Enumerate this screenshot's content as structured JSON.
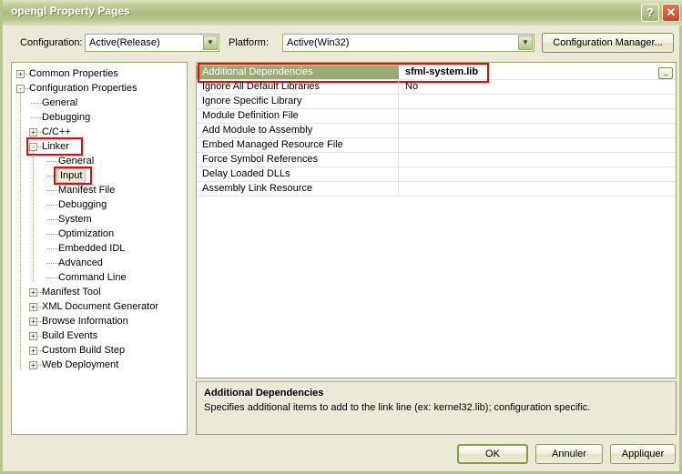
{
  "window": {
    "title": "opengl Property Pages",
    "help_label": "?",
    "close_label": "✕"
  },
  "config_bar": {
    "configuration_label": "Configuration:",
    "configuration_value": "Active(Release)",
    "platform_label": "Platform:",
    "platform_value": "Active(Win32)",
    "configuration_manager_label": "Configuration Manager..."
  },
  "tree": {
    "items": [
      {
        "label": "Common Properties",
        "indent": 0,
        "expander": "+",
        "selected": false,
        "annotated": false
      },
      {
        "label": "Configuration Properties",
        "indent": 0,
        "expander": "-",
        "selected": false,
        "annotated": false
      },
      {
        "label": "General",
        "indent": 1,
        "expander": "",
        "selected": false,
        "annotated": false
      },
      {
        "label": "Debugging",
        "indent": 1,
        "expander": "",
        "selected": false,
        "annotated": false
      },
      {
        "label": "C/C++",
        "indent": 1,
        "expander": "+",
        "selected": false,
        "annotated": false
      },
      {
        "label": "Linker",
        "indent": 1,
        "expander": "-",
        "selected": false,
        "annotated": true
      },
      {
        "label": "General",
        "indent": 2,
        "expander": "",
        "selected": false,
        "annotated": false
      },
      {
        "label": "Input",
        "indent": 2,
        "expander": "",
        "selected": true,
        "annotated": true
      },
      {
        "label": "Manifest File",
        "indent": 2,
        "expander": "",
        "selected": false,
        "annotated": false
      },
      {
        "label": "Debugging",
        "indent": 2,
        "expander": "",
        "selected": false,
        "annotated": false
      },
      {
        "label": "System",
        "indent": 2,
        "expander": "",
        "selected": false,
        "annotated": false
      },
      {
        "label": "Optimization",
        "indent": 2,
        "expander": "",
        "selected": false,
        "annotated": false
      },
      {
        "label": "Embedded IDL",
        "indent": 2,
        "expander": "",
        "selected": false,
        "annotated": false
      },
      {
        "label": "Advanced",
        "indent": 2,
        "expander": "",
        "selected": false,
        "annotated": false
      },
      {
        "label": "Command Line",
        "indent": 2,
        "expander": "",
        "selected": false,
        "annotated": false
      },
      {
        "label": "Manifest Tool",
        "indent": 1,
        "expander": "+",
        "selected": false,
        "annotated": false
      },
      {
        "label": "XML Document Generator",
        "indent": 1,
        "expander": "+",
        "selected": false,
        "annotated": false
      },
      {
        "label": "Browse Information",
        "indent": 1,
        "expander": "+",
        "selected": false,
        "annotated": false
      },
      {
        "label": "Build Events",
        "indent": 1,
        "expander": "+",
        "selected": false,
        "annotated": false
      },
      {
        "label": "Custom Build Step",
        "indent": 1,
        "expander": "+",
        "selected": false,
        "annotated": false
      },
      {
        "label": "Web Deployment",
        "indent": 1,
        "expander": "+",
        "selected": false,
        "annotated": false
      }
    ]
  },
  "grid": {
    "rows": [
      {
        "name": "Additional Dependencies",
        "value": "sfml-system.lib",
        "selected": true,
        "has_ellipsis": true
      },
      {
        "name": "Ignore All Default Libraries",
        "value": "No",
        "selected": false,
        "has_ellipsis": false
      },
      {
        "name": "Ignore Specific Library",
        "value": "",
        "selected": false,
        "has_ellipsis": false
      },
      {
        "name": "Module Definition File",
        "value": "",
        "selected": false,
        "has_ellipsis": false
      },
      {
        "name": "Add Module to Assembly",
        "value": "",
        "selected": false,
        "has_ellipsis": false
      },
      {
        "name": "Embed Managed Resource File",
        "value": "",
        "selected": false,
        "has_ellipsis": false
      },
      {
        "name": "Force Symbol References",
        "value": "",
        "selected": false,
        "has_ellipsis": false
      },
      {
        "name": "Delay Loaded DLLs",
        "value": "",
        "selected": false,
        "has_ellipsis": false
      },
      {
        "name": "Assembly Link Resource",
        "value": "",
        "selected": false,
        "has_ellipsis": false
      }
    ],
    "ellipsis_label": "..."
  },
  "description": {
    "title": "Additional Dependencies",
    "body": "Specifies additional items to add to the link line (ex: kernel32.lib); configuration specific."
  },
  "buttons": {
    "ok": "OK",
    "cancel": "Annuler",
    "apply": "Appliquer"
  },
  "colors": {
    "title_bar": "#aebb80",
    "selection": "#9aaa72",
    "dialog_background": "#ece9d8",
    "annotation": "#ff0000",
    "close_button": "#c9442a"
  }
}
